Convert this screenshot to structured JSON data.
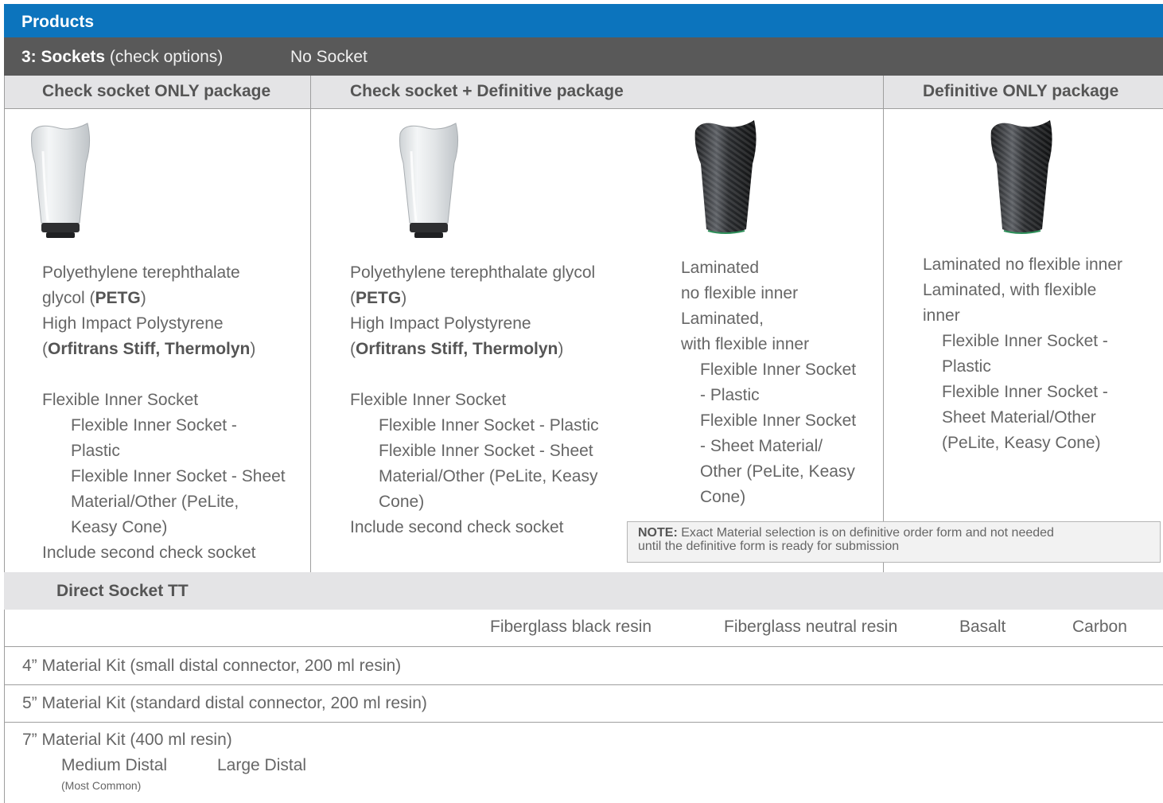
{
  "products_title": "Products",
  "sockets": {
    "label_bold": "3: Sockets",
    "label_light": " (check options)",
    "no_socket": "No Socket"
  },
  "columns": {
    "check_only": "Check socket ONLY package",
    "check_definitive": "Check socket + Definitive package",
    "definitive_only": "Definitive ONLY package"
  },
  "check_only": {
    "petg_line1": "Polyethylene terephthalate",
    "petg_line2_pre": "glycol (",
    "petg_bold": "PETG",
    "petg_close": ")",
    "hips_line": "High Impact Polystyrene",
    "hips_open": "(",
    "hips_bold": "Orfitrans Stiff, Thermolyn",
    "hips_close": ")",
    "flex_inner": "Flexible Inner Socket",
    "flex_plastic_1": "Flexible Inner Socket -",
    "flex_plastic_2": "Plastic",
    "flex_sheet_1": "Flexible Inner Socket - Sheet",
    "flex_sheet_2": "Material/Other (PeLite,",
    "flex_sheet_3": "Keasy Cone)",
    "second_check": "Include second check socket"
  },
  "check_definitive_left": {
    "petg_line1": "Polyethylene terephthalate glycol",
    "petg_open": "(",
    "petg_bold": "PETG",
    "petg_close": ")",
    "hips_line": "High Impact Polystyrene",
    "hips_open": "(",
    "hips_bold": "Orfitrans Stiff, Thermolyn",
    "hips_close": ")",
    "flex_inner": "Flexible Inner Socket",
    "flex_plastic": "Flexible Inner Socket - Plastic",
    "flex_sheet_1": "Flexible Inner Socket - Sheet",
    "flex_sheet_2": "Material/Other (PeLite, Keasy",
    "flex_sheet_3": "Cone)",
    "second_check": "Include second check socket"
  },
  "check_definitive_right": {
    "lam1": "Laminated",
    "lam2": "no flexible inner",
    "lam3": "Laminated,",
    "lam4": "with flexible inner",
    "flex_plastic_1": "Flexible Inner Socket",
    "flex_plastic_2": "- Plastic",
    "flex_sheet_1": "Flexible Inner Socket",
    "flex_sheet_2": "- Sheet Material/",
    "flex_sheet_3": "Other (PeLite, Keasy",
    "flex_sheet_4": "Cone)"
  },
  "definitive_only": {
    "lam_no_flex": "Laminated no flexible inner",
    "lam_with_1": "Laminated, with flexible",
    "lam_with_2": "inner",
    "flex_plastic_1": "Flexible Inner Socket -",
    "flex_plastic_2": "Plastic",
    "flex_sheet_1": "Flexible Inner Socket -",
    "flex_sheet_2": "Sheet Material/Other",
    "flex_sheet_3": "(PeLite, Keasy Cone)"
  },
  "note": {
    "label": "NOTE:",
    "line1": " Exact Material selection is on definitive order form and not needed",
    "line2": "until the definitive form is ready for submission"
  },
  "direct_socket": {
    "title": "Direct Socket TT",
    "materials": [
      "Fiberglass black resin",
      "Fiberglass neutral resin",
      "Basalt",
      "Carbon"
    ],
    "kits": [
      "4” Material Kit (small distal connector, 200 ml resin)",
      "5” Material Kit (standard distal connector, 200 ml resin)",
      "7” Material Kit (400 ml resin)"
    ],
    "distal_medium": "Medium Distal",
    "distal_medium_note": "(Most Common)",
    "distal_large": "Large Distal"
  },
  "colors": {
    "header_blue": "#0c74bd",
    "section_gray": "#595959",
    "column_header": "#e4e4e6"
  },
  "icons": [
    "clear-check-socket-image",
    "carbon-definitive-socket-image"
  ]
}
